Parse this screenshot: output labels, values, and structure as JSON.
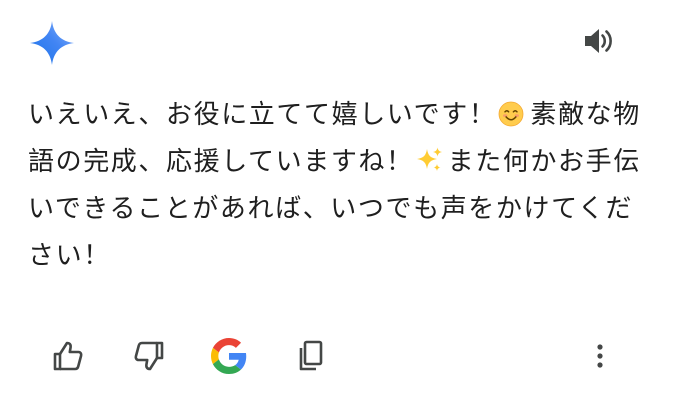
{
  "message": {
    "part1": "いえいえ、お役に立てて嬉しいです！",
    "emoji1": "smiling-face-emoji",
    "part2": "素敵な物語の完成、応援していますね！",
    "emoji2": "sparkles-emoji",
    "part3": "また何かお手伝いできることがあれば、いつでも声をかけてください！"
  },
  "icons": {
    "logo": "gemini-sparkle-icon",
    "speaker": "speaker-icon",
    "thumb_up": "thumb-up-icon",
    "thumb_down": "thumb-down-icon",
    "google": "google-g-icon",
    "copy": "copy-icon",
    "more": "more-vertical-icon"
  },
  "colors": {
    "text": "#1f1f1f",
    "icon": "#444746",
    "sparkle_start": "#4285f4",
    "sparkle_end": "#9b72cb",
    "google_blue": "#4285F4",
    "google_red": "#EA4335",
    "google_yellow": "#FBBC05",
    "google_green": "#34A853"
  }
}
